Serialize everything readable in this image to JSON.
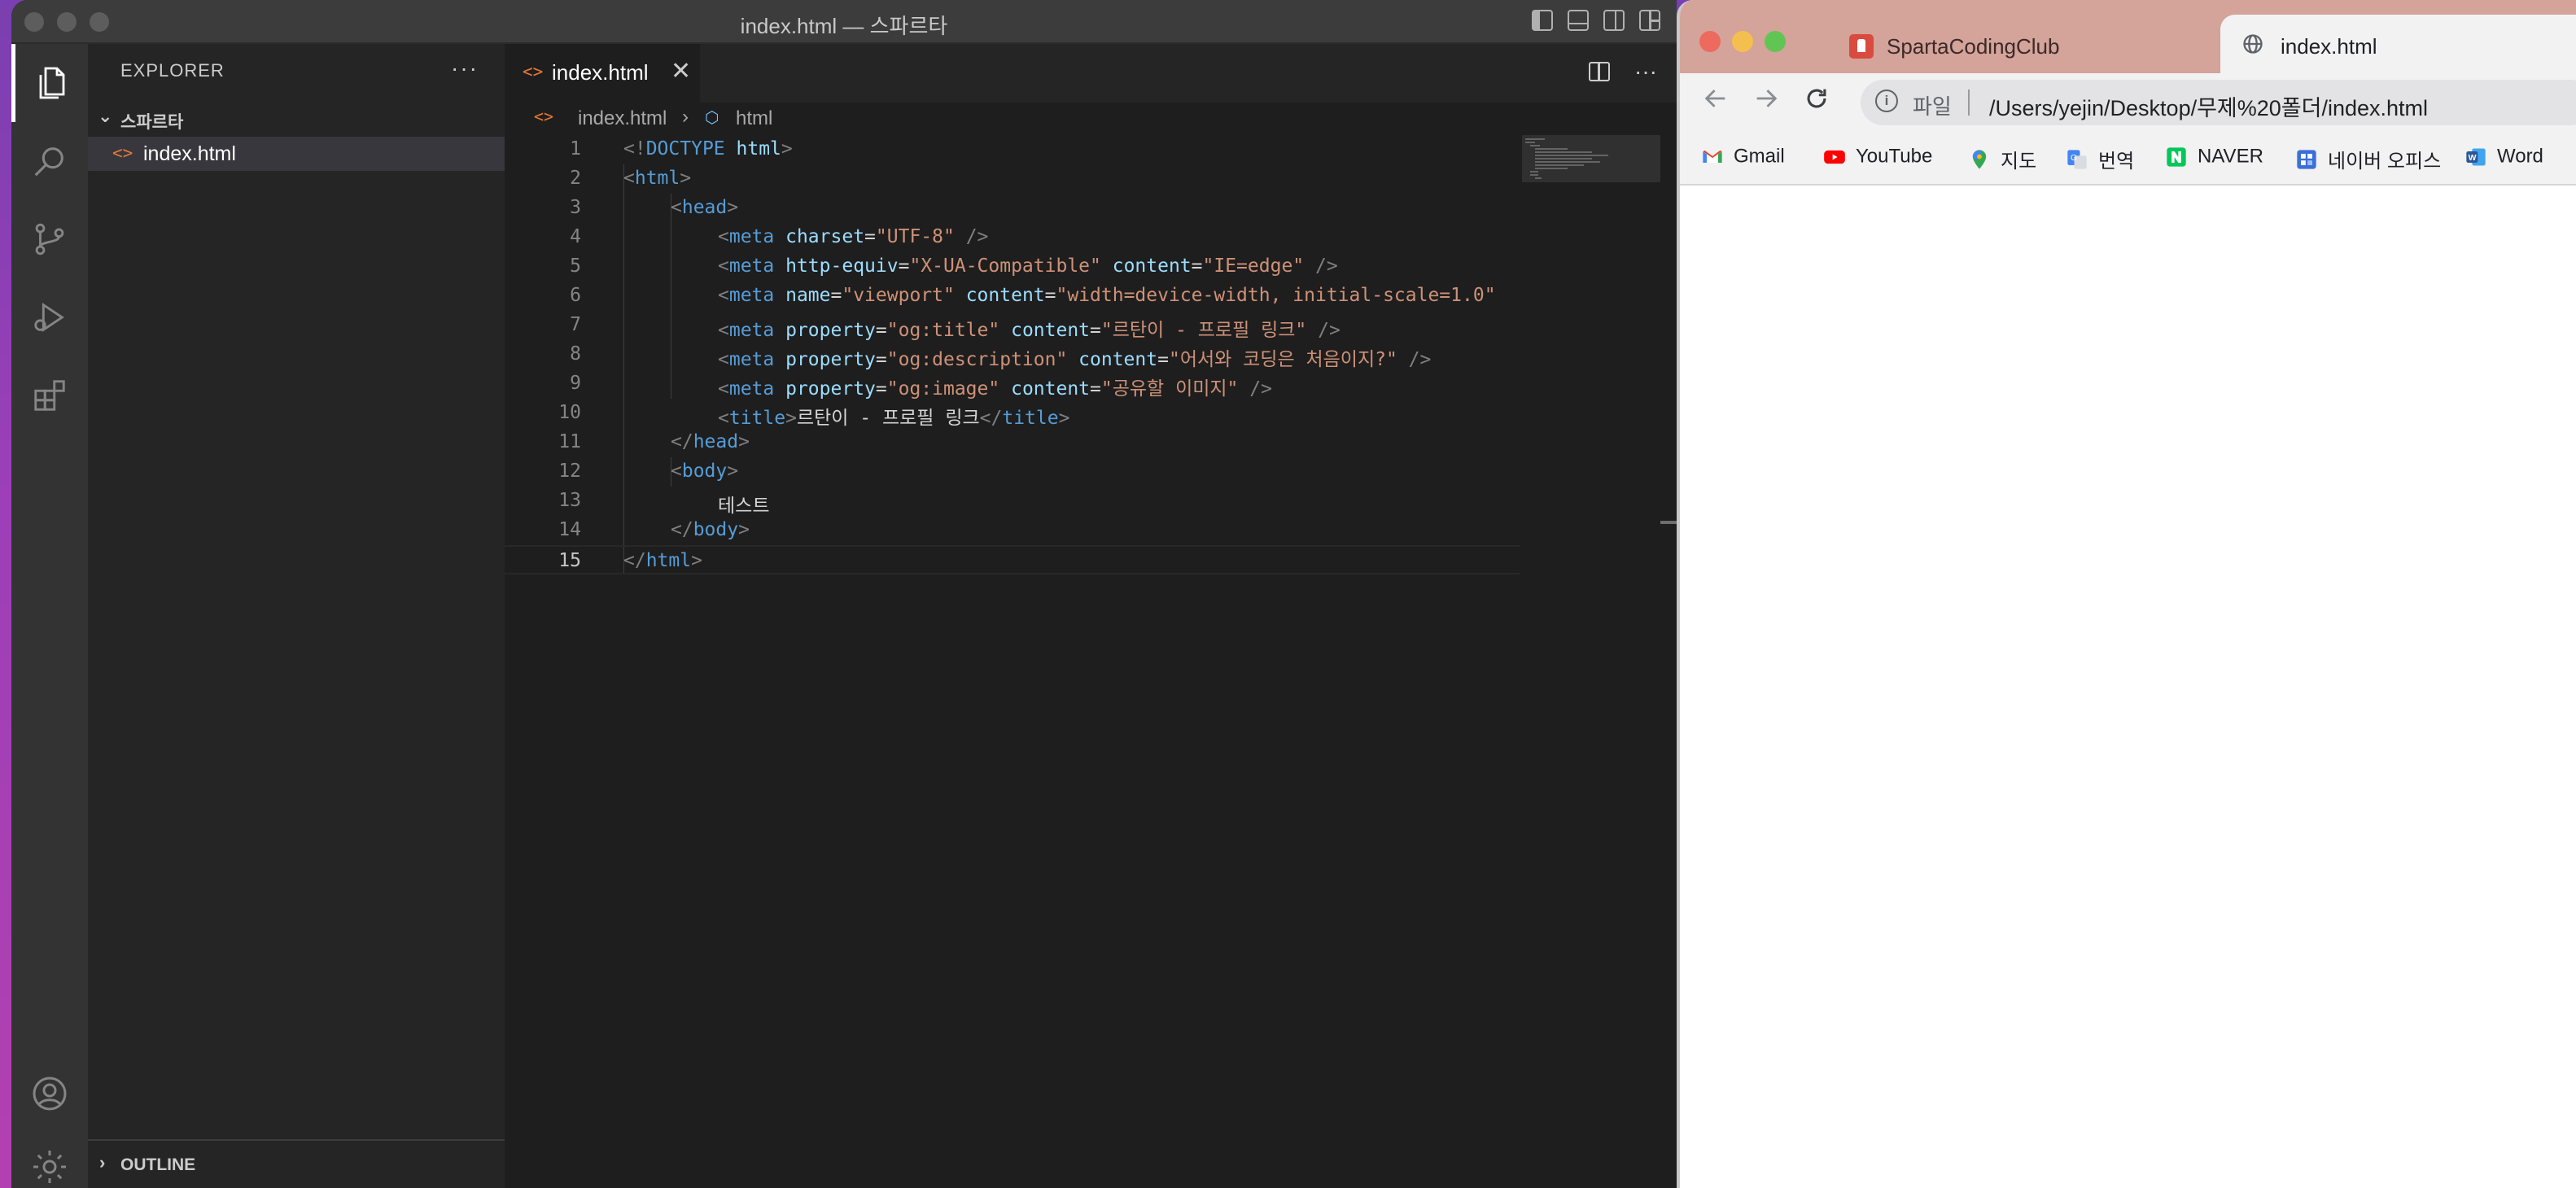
{
  "vscode": {
    "window_title": "index.html — 스파르타",
    "sidebar": {
      "title": "EXPLORER",
      "more": "···",
      "folder": "스파르타",
      "file": "index.html",
      "outline": "OUTLINE"
    },
    "tab": {
      "label": "index.html",
      "close": "✕"
    },
    "breadcrumb": {
      "file": "index.html",
      "separator": "›",
      "node": "html"
    },
    "tab_actions_more": "···",
    "code_lines": [
      {
        "n": "1"
      },
      {
        "n": "2"
      },
      {
        "n": "3"
      },
      {
        "n": "4"
      },
      {
        "n": "5"
      },
      {
        "n": "6"
      },
      {
        "n": "7"
      },
      {
        "n": "8"
      },
      {
        "n": "9"
      },
      {
        "n": "10"
      },
      {
        "n": "11"
      },
      {
        "n": "12"
      },
      {
        "n": "13"
      },
      {
        "n": "14"
      },
      {
        "n": "15"
      }
    ],
    "code": {
      "l1": {
        "lt": "<!",
        "kw": "DOCTYPE",
        "sp": " ",
        "attr": "html",
        "gt": ">"
      },
      "l2": {
        "lt": "<",
        "tag": "html",
        "gt": ">"
      },
      "l3": {
        "lt": "<",
        "tag": "head",
        "gt": ">"
      },
      "l4": {
        "tag": "meta",
        "attr": "charset",
        "val": "\"UTF-8\"",
        "end": " />"
      },
      "l5": {
        "tag": "meta",
        "attr1": "http-equiv",
        "val1": "\"X-UA-Compatible\"",
        "attr2": "content",
        "val2": "\"IE=edge\"",
        "end": " />"
      },
      "l6": {
        "tag": "meta",
        "attr1": "name",
        "val1": "\"viewport\"",
        "attr2": "content",
        "val2": "\"width=device-width, initial-scale=1.0\""
      },
      "l7": {
        "tag": "meta",
        "attr1": "property",
        "val1": "\"og:title\"",
        "attr2": "content",
        "val2": "\"르탄이 - 프로필 링크\"",
        "end": " />"
      },
      "l8": {
        "tag": "meta",
        "attr1": "property",
        "val1": "\"og:description\"",
        "attr2": "content",
        "val2": "\"어서와 코딩은 처음이지?\"",
        "end": " />"
      },
      "l9": {
        "tag": "meta",
        "attr1": "property",
        "val1": "\"og:image\"",
        "attr2": "content",
        "val2": "\"공유할 이미지\"",
        "end": " />"
      },
      "l10": {
        "tag": "title",
        "text": "르탄이 - 프로필 링크",
        "close": "title"
      },
      "l11": {
        "close": "head"
      },
      "l12": {
        "tag": "body"
      },
      "l13": {
        "text": "테스트"
      },
      "l14": {
        "close": "body"
      },
      "l15": {
        "close": "html"
      }
    },
    "icons": [
      "files-icon",
      "search-icon",
      "source-control-icon",
      "run-debug-icon",
      "extensions-icon",
      "account-icon",
      "settings-gear-icon"
    ]
  },
  "chrome": {
    "tabs": [
      {
        "label": "SpartaCodingClub",
        "close": "✕"
      },
      {
        "label": "index.html"
      }
    ],
    "omnibox": {
      "scheme": "파일",
      "url": "/Users/yejin/Desktop/무제%20폴더/index.html"
    },
    "bookmarks": [
      {
        "label": "Gmail",
        "color": "#ea4335"
      },
      {
        "label": "YouTube",
        "color": "#ff0000"
      },
      {
        "label": "지도",
        "color": "#34a853"
      },
      {
        "label": "번역",
        "color": "#4285f4"
      },
      {
        "label": "NAVER",
        "color": "#03c75a"
      },
      {
        "label": "네이버 오피스",
        "color": "#3b6fd8"
      },
      {
        "label": "Word",
        "color": "#2b579a"
      }
    ],
    "colors": {
      "close": "#ed6a5e",
      "minimize": "#f5bf4f",
      "maximize": "#61c554"
    }
  }
}
